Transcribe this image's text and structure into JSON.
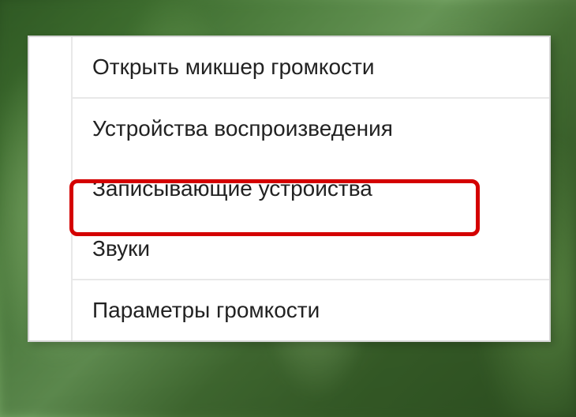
{
  "contextMenu": {
    "items": [
      {
        "label": "Открыть микшер громкости"
      },
      {
        "label": "Устройства воспроизведения"
      },
      {
        "label": "Записывающие устройства"
      },
      {
        "label": "Звуки"
      },
      {
        "label": "Параметры громкости"
      }
    ],
    "highlightedIndex": 2
  }
}
